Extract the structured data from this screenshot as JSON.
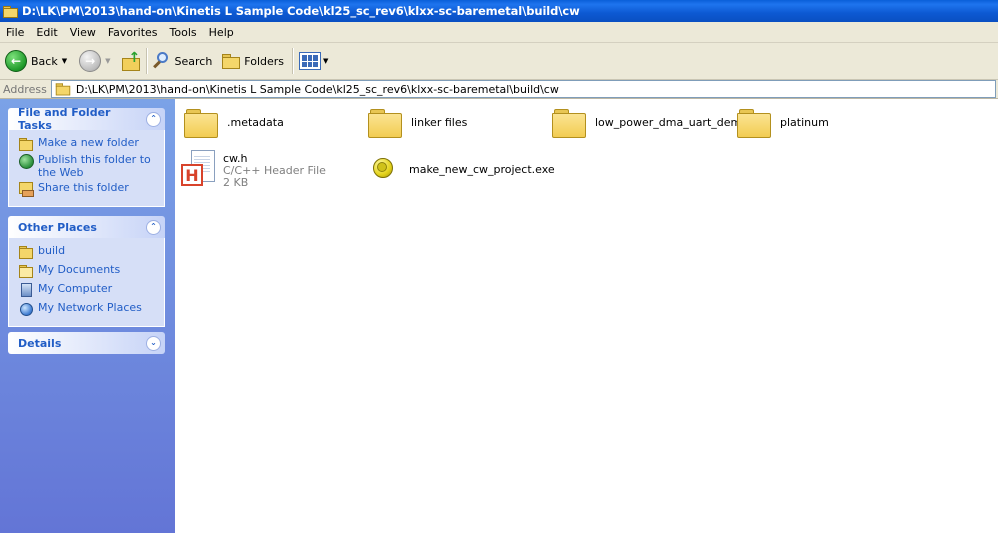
{
  "window": {
    "title": "D:\\LK\\PM\\2013\\hand-on\\Kinetis L Sample Code\\kl25_sc_rev6\\klxx-sc-baremetal\\build\\cw"
  },
  "menu": [
    "File",
    "Edit",
    "View",
    "Favorites",
    "Tools",
    "Help"
  ],
  "toolbar": {
    "back_label": "Back",
    "search_label": "Search",
    "folders_label": "Folders"
  },
  "address": {
    "label": "Address",
    "value": "D:\\LK\\PM\\2013\\hand-on\\Kinetis L Sample Code\\kl25_sc_rev6\\klxx-sc-baremetal\\build\\cw"
  },
  "tasks": {
    "file_folder": {
      "title": "File and Folder Tasks",
      "items": [
        "Make a new folder",
        "Publish this folder to the Web",
        "Share this folder"
      ]
    },
    "other_places": {
      "title": "Other Places",
      "items": [
        "build",
        "My Documents",
        "My Computer",
        "My Network Places"
      ]
    },
    "details": {
      "title": "Details"
    }
  },
  "content": {
    "folders": [
      ".metadata",
      "linker files",
      "low_power_dma_uart_demo",
      "platinum"
    ],
    "header_file": {
      "name": "cw.h",
      "type": "C/C++ Header File",
      "size": "2 KB"
    },
    "exe_file": {
      "name": "make_new_cw_project.exe"
    }
  },
  "colors": {
    "titlebar": "#0a5fd8",
    "taskpane_top": "#7ba2e7",
    "taskpane_bottom": "#6375d6",
    "link": "#215dc6"
  }
}
